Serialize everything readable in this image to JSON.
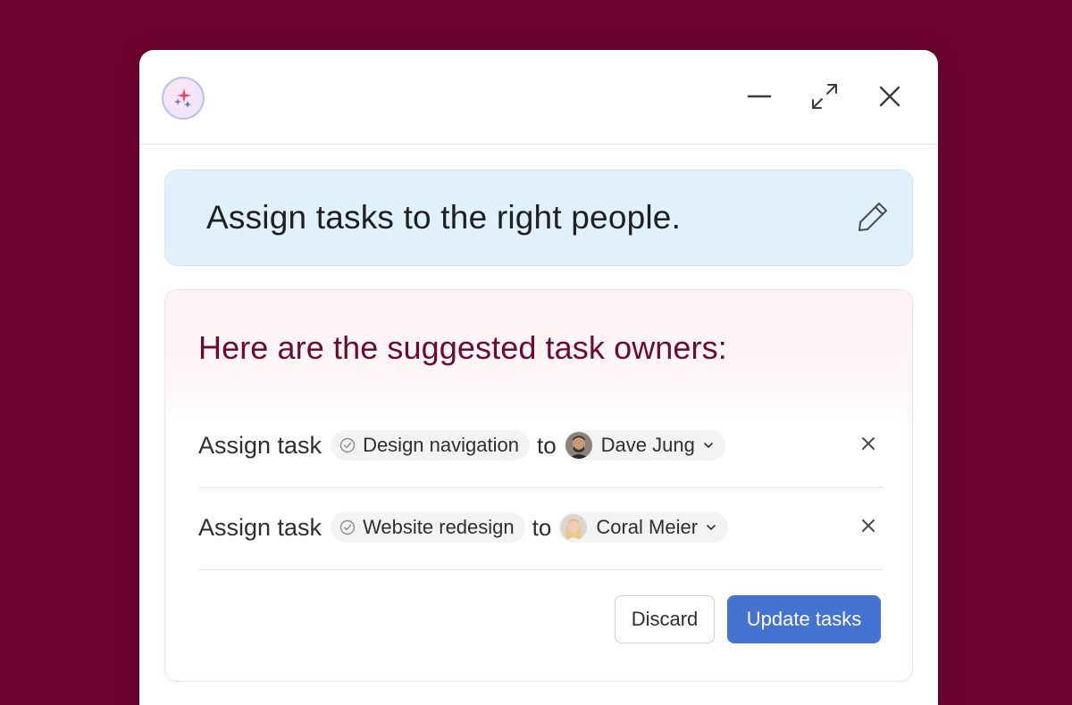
{
  "window": {
    "logo_icon": "sparkles-icon",
    "controls": [
      {
        "name": "minimize",
        "icon": "minimize-icon"
      },
      {
        "name": "expand",
        "icon": "expand-icon"
      },
      {
        "name": "close",
        "icon": "close-icon"
      }
    ]
  },
  "prompt": {
    "text": "Assign tasks to the right people.",
    "edit_icon": "pencil-icon"
  },
  "result": {
    "heading": "Here are the suggested task owners:",
    "rows": [
      {
        "prefix": "Assign task",
        "task": "Design navigation",
        "connector": "to",
        "assignee": "Dave Jung"
      },
      {
        "prefix": "Assign task",
        "task": "Website redesign",
        "connector": "to",
        "assignee": "Coral Meier"
      }
    ],
    "actions": {
      "discard": "Discard",
      "update": "Update tasks"
    }
  },
  "colors": {
    "background": "#6f0331",
    "heading": "#6c0a35",
    "prompt_bg": "#e0f1fb",
    "primary_button": "#4573d2"
  }
}
